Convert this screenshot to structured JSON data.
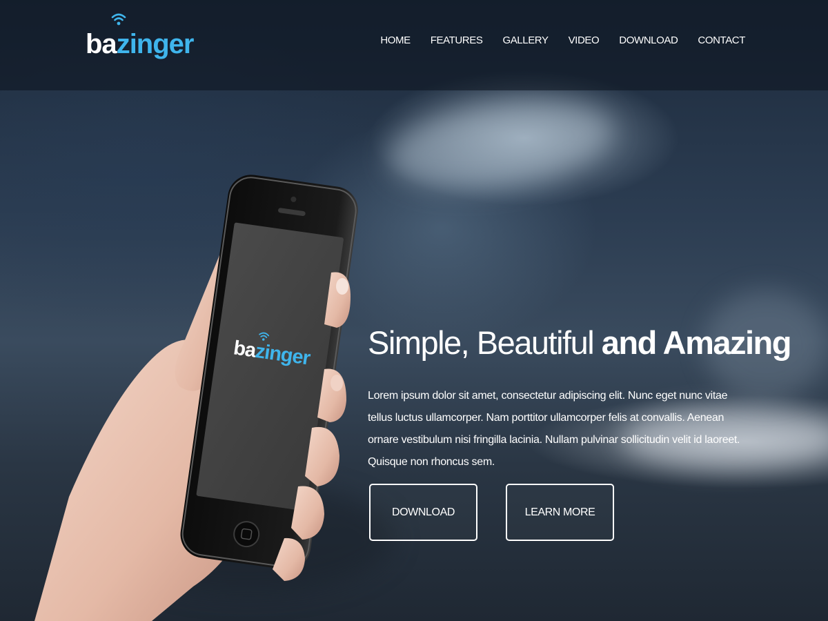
{
  "logo": {
    "part1": "ba",
    "part2": "zinger",
    "icon": "wifi-icon",
    "accent_color": "#3fb5ec"
  },
  "nav": {
    "items": [
      "HOME",
      "FEATURES",
      "GALLERY",
      "VIDEO",
      "DOWNLOAD",
      "CONTACT"
    ]
  },
  "hero": {
    "headline_light": "Simple, Beautiful ",
    "headline_bold": "and Amazing",
    "description": "Lorem ipsum dolor sit amet, consectetur adipiscing elit. Nunc eget nunc vitae tellus luctus ullamcorper. Nam porttitor ullamcorper felis at convallis. Aenean ornare vestibulum nisi fringilla lacinia. Nullam pulvinar sollicitudin velit id laoreet. Quisque non rhoncus sem.",
    "download_label": "DOWNLOAD",
    "learn_more_label": "LEARN MORE"
  },
  "phone": {
    "screen_logo_part1": "ba",
    "screen_logo_part2": "zinger"
  }
}
